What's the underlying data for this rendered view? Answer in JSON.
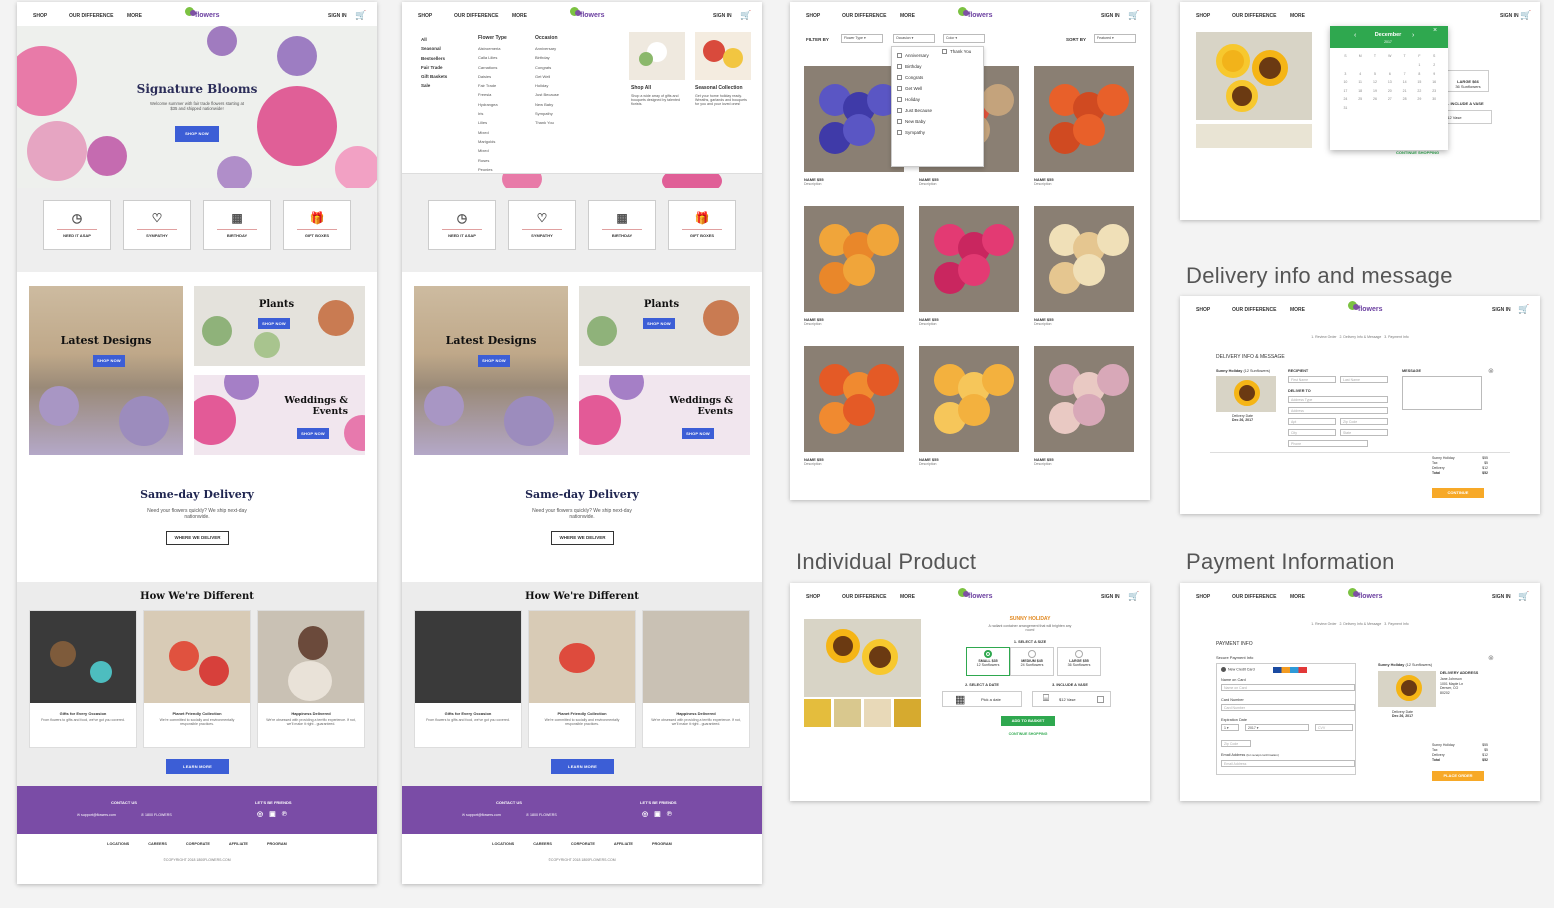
{
  "nav": {
    "shop": "SHOP",
    "difference": "OUR DIFFERENCE",
    "more": "MORE",
    "signin": "SIGN IN",
    "logo": "flowers"
  },
  "home": {
    "hero_title": "Signature Blooms",
    "hero_sub": "Welcome summer with fair trade flowers starting at $35 and shipped nationwide!",
    "shop_now": "SHOP NOW",
    "cats": [
      "NEED IT ASAP",
      "SYMPATHY",
      "BIRTHDAY",
      "GIFT BOXES"
    ],
    "latest": "Latest Designs",
    "plants": "Plants",
    "weddings": "Weddings & Events",
    "sameday": "Same-day Delivery",
    "sameday_sub": "Need your flowers quickly? We ship next-day nationwide.",
    "where": "WHERE WE DELIVER",
    "different": "How We're Different",
    "diff_cards": [
      {
        "t": "Gifts for Every Occasion",
        "d": "From flowers to gifts and food, we've got you covered."
      },
      {
        "t": "Planet Friendly Collection",
        "d": "We're committed to socially and environmentally responsible practices."
      },
      {
        "t": "Happiness Delivered",
        "d": "We're obsessed with providing a terrific experience. If not, we'll make it right - guaranteed."
      }
    ],
    "learn": "LEARN MORE",
    "contact": "CONTACT US",
    "friends": "LET'S BE FRIENDS",
    "email": "support@flowers.com",
    "phone": "1800 FLOWERS",
    "links": [
      "LOCATIONS",
      "CAREERS",
      "CORPORATE",
      "AFFILIATE PROGRAM"
    ],
    "copyright": "©COPYRIGHT 2018 1800FLOWERS.COM"
  },
  "menu": {
    "col1": [
      "All",
      "Seasonal",
      "Bestsellers",
      "Fair Trade",
      "Gift Baskets",
      "Sale"
    ],
    "ft_head": "Flower Type",
    "ft": [
      "Alstroemeria",
      "Calla Lilies",
      "Carnations",
      "Daisies",
      "Fair Trade",
      "Freesia",
      "Hydrangea",
      "Iris",
      "Lilies",
      "Mixed",
      "Marigolds",
      "Mixed",
      "Roses",
      "Peonies"
    ],
    "oc_head": "Occasion",
    "oc": [
      "Anniversary",
      "Birthday",
      "Congrats",
      "Get Well",
      "Holiday",
      "Just Because",
      "New Baby",
      "Sympathy",
      "Thank You"
    ],
    "shop_all": "Shop All",
    "shop_all_d": "Shop a wide array of gifts and bouquets designed by talented florists.",
    "seasonal": "Seasonal Collection",
    "seasonal_d": "Get your home holiday ready. Wreaths, garlands and bouquets for you and your loved ones!"
  },
  "listing": {
    "filter_by": "FILTER BY",
    "flower_type": "Flower Type",
    "occasion": "Occasion",
    "color": "Color",
    "sort_by": "SORT BY",
    "featured": "Featured",
    "occ_opts": [
      "Anniversary",
      "Birthday",
      "Congrats",
      "Get Well",
      "Holiday",
      "Just Because",
      "New Baby",
      "Sympathy"
    ],
    "occ_extra": "Thank You",
    "name": "NAME $55",
    "desc": "Description"
  },
  "labels": {
    "delivery": "Delivery info and message",
    "product": "Individual Product",
    "payment": "Payment Information"
  },
  "calendar": {
    "month": "December",
    "year": "2017",
    "days": [
      "S",
      "M",
      "T",
      "W",
      "T",
      "F",
      "S"
    ],
    "large": "LARGE $66",
    "large_sub": "36 Sunflowers",
    "vase": "3. INCLUDE A VASE",
    "vase_price": "$12 Vase",
    "continue": "CONTINUE SHOPPING"
  },
  "delivery": {
    "steps": "1. Review Order   2. Delivery Info & Message   3. Payment Info",
    "title": "DELIVERY INFO & MESSAGE",
    "product": "Sunny Holiday",
    "product_sub": "(12 Sunflowers)",
    "recipient": "RECIPIENT",
    "deliver_to": "DELIVER TO",
    "message": "MESSAGE",
    "fields": [
      "First Name",
      "Last Name",
      "Address Type",
      "Address",
      "Apt",
      "Zip Code",
      "City",
      "State",
      "Phone"
    ],
    "delivery_date": "Delivery Date",
    "date": "Dec 26, 2017",
    "totals": [
      [
        "Sunny Holiday",
        "$55"
      ],
      [
        "Tax",
        "$5"
      ],
      [
        "Delivery",
        "$12"
      ],
      [
        "Total",
        "$52"
      ]
    ],
    "continue": "CONTINUE"
  },
  "product": {
    "name": "SUNNY HOLIDAY",
    "desc": "A radiant container arrangement that will brighten any room!",
    "size_head": "1. SELECT A SIZE",
    "sizes": [
      [
        "SMALL $35",
        "12 Sunflowers"
      ],
      [
        "MEDIUM $45",
        "24 Sunflowers"
      ],
      [
        "LARGE $55",
        "36 Sunflowers"
      ]
    ],
    "date_head": "2. SELECT A DATE",
    "pick": "Pick a date",
    "vase_head": "3. INCLUDE A VASE",
    "vase": "$12 Vase",
    "add": "ADD TO BASKET",
    "continue": "CONTINUE SHOPPING"
  },
  "payment": {
    "steps": "1. Review Order   2. Delivery Info & Message   3. Payment Info",
    "title": "PAYMENT INFO",
    "secure": "Secure Payment Info",
    "new_card": "New Credit Card",
    "name_on_card": "Name on Card",
    "card_number": "Card Number",
    "expiration": "Expiration Date",
    "month": "1",
    "year": "2017",
    "cvv": "CVV",
    "zip": "Zip Code",
    "email": "Email Address",
    "email_note": "(for receipt confirmation)",
    "product": "Sunny Holiday",
    "product_sub": "(12 Sunflowers)",
    "delivery_address": "DELIVERY ADDRESS",
    "addr": [
      "Jane Johnson",
      "1001 Maple Ln",
      "Denver, CO",
      "80202"
    ],
    "delivery_date": "Delivery Date",
    "date": "Dec 26, 2017",
    "totals": [
      [
        "Sunny Holiday",
        "$55"
      ],
      [
        "Tax",
        "$5"
      ],
      [
        "Delivery",
        "$12"
      ],
      [
        "Total",
        "$52"
      ]
    ],
    "place": "PLACE ORDER"
  },
  "colors": {
    "purple": "#7a4ca6",
    "blue": "#3c5ed6",
    "orange": "#f7a928",
    "green": "#2fa84f"
  }
}
